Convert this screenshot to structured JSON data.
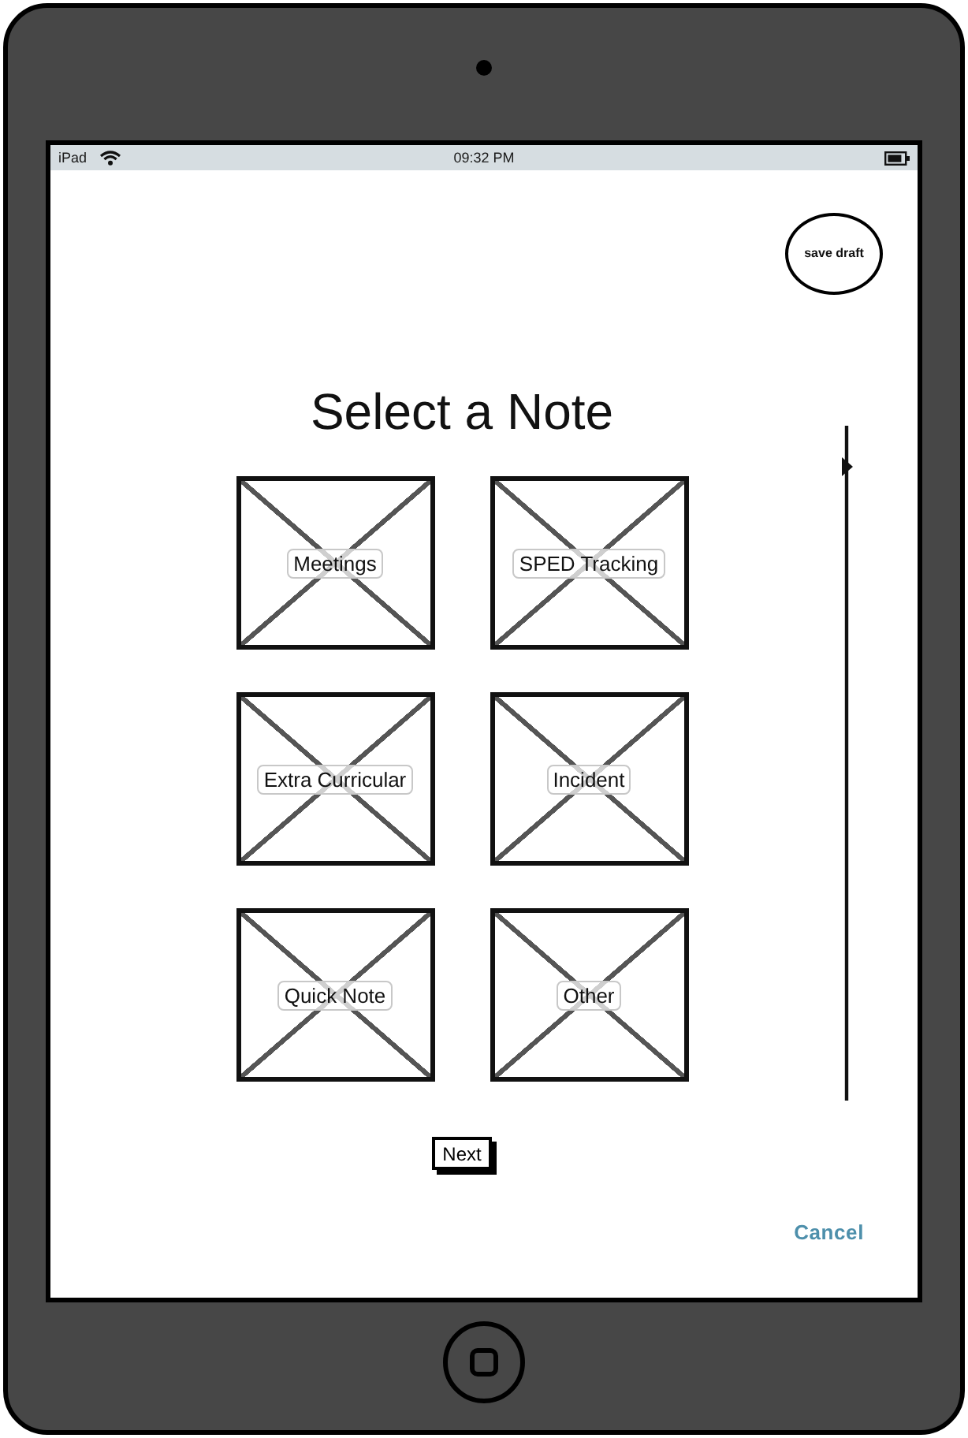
{
  "status_bar": {
    "carrier": "iPad",
    "time": "09:32 PM"
  },
  "save_draft": {
    "label": "save draft"
  },
  "title": "Select a Note",
  "notes": [
    {
      "label": "Meetings"
    },
    {
      "label": "SPED Tracking"
    },
    {
      "label": "Extra Curricular"
    },
    {
      "label": "Incident"
    },
    {
      "label": "Quick Note"
    },
    {
      "label": "Other"
    }
  ],
  "next_button": {
    "label": "Next"
  },
  "cancel_link": {
    "label": "Cancel"
  }
}
